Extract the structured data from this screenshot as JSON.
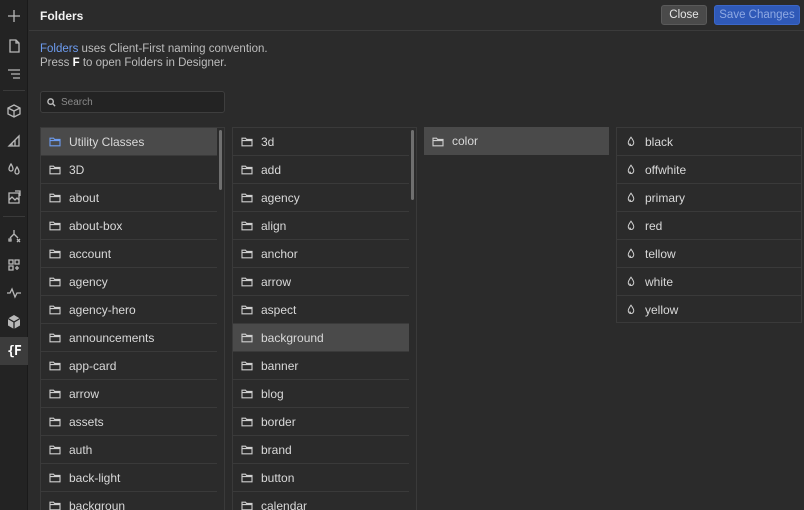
{
  "header": {
    "title": "Folders",
    "close_label": "Close",
    "save_label": "Save Changes"
  },
  "intro": {
    "link_text": "Folders",
    "line1_rest": " uses Client-First naming convention.",
    "line2_pre": "Press ",
    "line2_key": "F",
    "line2_post": " to open Folders in Designer."
  },
  "search": {
    "placeholder": "Search",
    "value": ""
  },
  "colors": {
    "accent": "#2f59b8",
    "link": "#6d9cf0",
    "background": "#2b2b2b",
    "selected_row": "#4a4a4a"
  },
  "rail_icons": [
    "plus-icon",
    "page-icon",
    "navigator-icon",
    "box-icon",
    "brush-icon",
    "drops-icon",
    "assets-icon",
    "logic-icon",
    "apps-icon",
    "activity-icon",
    "cube-icon",
    "folders-f-icon"
  ],
  "columns": {
    "col1": [
      {
        "label": "Utility Classes",
        "selected": true
      },
      {
        "label": "3D"
      },
      {
        "label": "about"
      },
      {
        "label": "about-box"
      },
      {
        "label": "account"
      },
      {
        "label": "agency"
      },
      {
        "label": "agency-hero"
      },
      {
        "label": "announcements"
      },
      {
        "label": "app-card"
      },
      {
        "label": "arrow"
      },
      {
        "label": "assets"
      },
      {
        "label": "auth"
      },
      {
        "label": "back-light"
      },
      {
        "label": "backgroun"
      }
    ],
    "col2": [
      {
        "label": "3d"
      },
      {
        "label": "add"
      },
      {
        "label": "agency"
      },
      {
        "label": "align"
      },
      {
        "label": "anchor"
      },
      {
        "label": "arrow"
      },
      {
        "label": "aspect"
      },
      {
        "label": "background",
        "selected": true
      },
      {
        "label": "banner"
      },
      {
        "label": "blog"
      },
      {
        "label": "border"
      },
      {
        "label": "brand"
      },
      {
        "label": "button"
      },
      {
        "label": "calendar"
      }
    ],
    "col3": [
      {
        "label": "color",
        "selected": true
      }
    ],
    "col4": [
      {
        "label": "black"
      },
      {
        "label": "offwhite"
      },
      {
        "label": "primary"
      },
      {
        "label": "red"
      },
      {
        "label": "tellow"
      },
      {
        "label": "white"
      },
      {
        "label": "yellow"
      }
    ]
  }
}
